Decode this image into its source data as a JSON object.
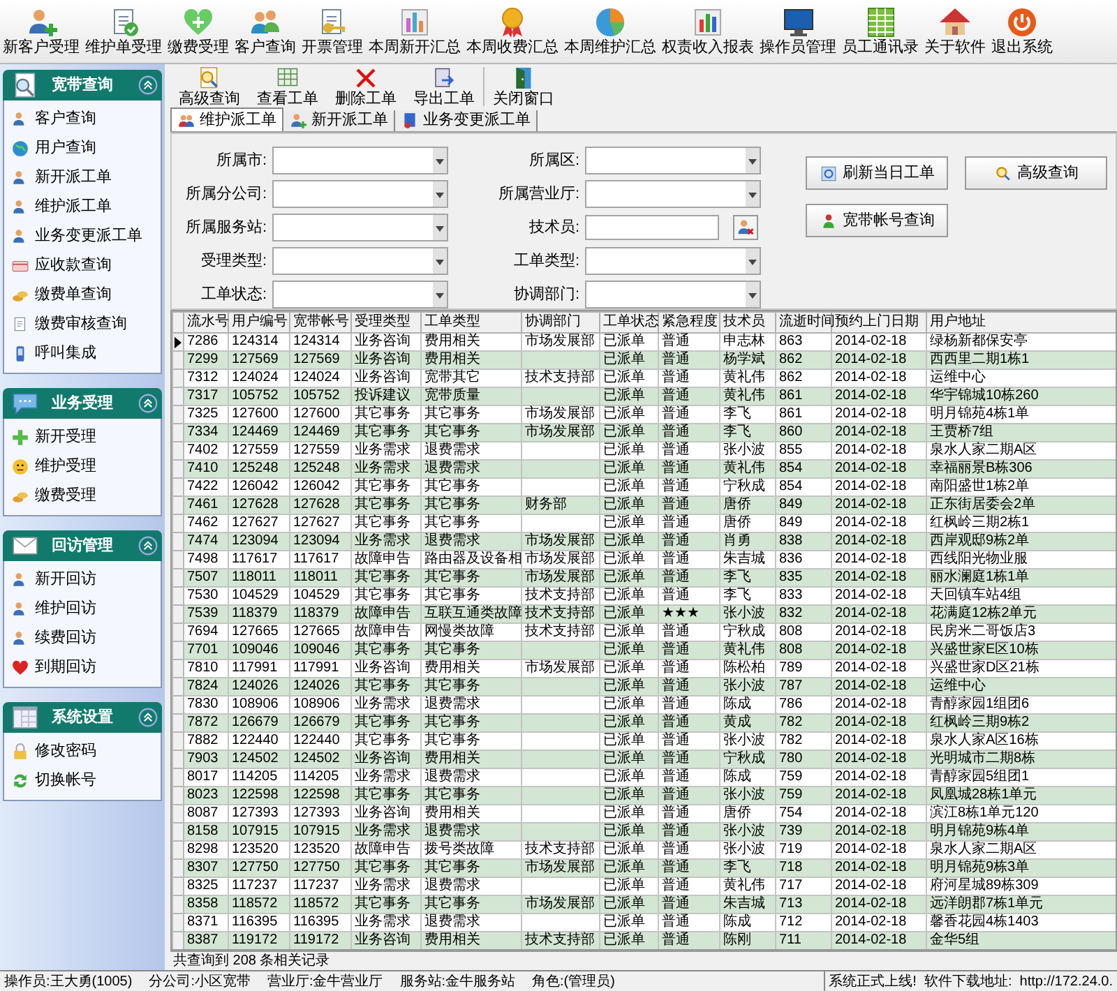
{
  "toolbar": [
    {
      "label": "新客户受理"
    },
    {
      "label": "维护单受理"
    },
    {
      "label": "缴费受理"
    },
    {
      "label": "客户查询"
    },
    {
      "label": "开票管理"
    },
    {
      "label": "本周新开汇总"
    },
    {
      "label": "本周收费汇总"
    },
    {
      "label": "本周维护汇总"
    },
    {
      "label": "权责收入报表"
    },
    {
      "label": "操作员管理"
    },
    {
      "label": "员工通讯录"
    },
    {
      "label": "关于软件"
    },
    {
      "label": "退出系统"
    }
  ],
  "sidebar": {
    "groups": [
      {
        "title": "宽带查询",
        "expanded": true,
        "items": [
          "客户查询",
          "用户查询",
          "新开派工单",
          "维护派工单",
          "业务变更派工单",
          "应收款查询",
          "缴费单查询",
          "缴费审核查询",
          "呼叫集成"
        ]
      },
      {
        "title": "业务受理",
        "expanded": true,
        "items": [
          "新开受理",
          "维护受理",
          "缴费受理"
        ]
      },
      {
        "title": "回访管理",
        "expanded": true,
        "items": [
          "新开回访",
          "维护回访",
          "续费回访",
          "到期回访"
        ]
      },
      {
        "title": "系统设置",
        "expanded": true,
        "items": [
          "修改密码",
          "切换帐号"
        ]
      }
    ]
  },
  "subtoolbar": [
    {
      "label": "高级查询"
    },
    {
      "label": "查看工单"
    },
    {
      "label": "删除工单"
    },
    {
      "label": "导出工单"
    },
    {
      "label": "关闭窗口"
    }
  ],
  "tabs": [
    {
      "label": "维护派工单",
      "selected": true
    },
    {
      "label": "新开派工单",
      "selected": false
    },
    {
      "label": "业务变更派工单",
      "selected": false
    }
  ],
  "filters": [
    {
      "label": "所属市:",
      "kind": "select"
    },
    {
      "label": "所属区:",
      "kind": "select"
    },
    {
      "label": "所属分公司:",
      "kind": "select"
    },
    {
      "label": "所属营业厅:",
      "kind": "select"
    },
    {
      "label": "所属服务站:",
      "kind": "select"
    },
    {
      "label": "技术员:",
      "kind": "text"
    },
    {
      "label": "受理类型:",
      "kind": "select"
    },
    {
      "label": "工单类型:",
      "kind": "select"
    },
    {
      "label": "工单状态:",
      "kind": "select"
    },
    {
      "label": "协调部门:",
      "kind": "select"
    }
  ],
  "buttons": [
    {
      "label": "刷新当日工单"
    },
    {
      "label": "高级查询"
    },
    {
      "label": "宽带帐号查询"
    }
  ],
  "table": {
    "columns": [
      "流水号",
      "用户编号",
      "宽带帐号",
      "受理类型",
      "工单类型",
      "协调部门",
      "工单状态",
      "紧急程度",
      "技术员",
      "流逝时间",
      "预约上门日期",
      "用户地址"
    ],
    "rows": [
      {
        "selected": true,
        "cells": [
          "7286",
          "124314",
          "124314",
          "业务咨询",
          "费用相关",
          "市场发展部",
          "已派单",
          "普通",
          "申志林",
          "863",
          "2014-02-18",
          "绿杨新都保安亭"
        ]
      },
      {
        "selected": false,
        "cells": [
          "7299",
          "127569",
          "127569",
          "业务咨询",
          "费用相关",
          null,
          "已派单",
          "普通",
          "杨学斌",
          "862",
          "2014-02-18",
          "西西里二期1栋1"
        ]
      },
      {
        "selected": false,
        "cells": [
          "7312",
          "124024",
          "124024",
          "业务咨询",
          "宽带其它",
          "技术支持部",
          "已派单",
          "普通",
          "黄礼伟",
          "862",
          "2014-02-18",
          "运维中心"
        ]
      },
      {
        "selected": false,
        "cells": [
          "7317",
          "105752",
          "105752",
          "投诉建议",
          "宽带质量",
          null,
          "已派单",
          "普通",
          "黄礼伟",
          "861",
          "2014-02-18",
          "华宇锦城10栋260"
        ]
      },
      {
        "selected": false,
        "cells": [
          "7325",
          "127600",
          "127600",
          "其它事务",
          "其它事务",
          "市场发展部",
          "已派单",
          "普通",
          "李飞",
          "861",
          "2014-02-18",
          "明月锦苑4栋1单"
        ]
      },
      {
        "selected": false,
        "cells": [
          "7334",
          "124469",
          "124469",
          "其它事务",
          "其它事务",
          "市场发展部",
          "已派单",
          "普通",
          "李飞",
          "860",
          "2014-02-18",
          "王贾桥7组"
        ]
      },
      {
        "selected": false,
        "cells": [
          "7402",
          "127559",
          "127559",
          "业务需求",
          "退费需求",
          null,
          "已派单",
          "普通",
          "张小波",
          "855",
          "2014-02-18",
          "泉水人家二期A区"
        ]
      },
      {
        "selected": false,
        "cells": [
          "7410",
          "125248",
          "125248",
          "业务需求",
          "退费需求",
          null,
          "已派单",
          "普通",
          "黄礼伟",
          "854",
          "2014-02-18",
          "幸福丽景B栋306"
        ]
      },
      {
        "selected": false,
        "cells": [
          "7422",
          "126042",
          "126042",
          "其它事务",
          "其它事务",
          null,
          "已派单",
          "普通",
          "宁秋成",
          "854",
          "2014-02-18",
          "南阳盛世1栋2单"
        ]
      },
      {
        "selected": false,
        "cells": [
          "7461",
          "127628",
          "127628",
          "其它事务",
          "其它事务",
          "财务部",
          "已派单",
          "普通",
          "唐侨",
          "849",
          "2014-02-18",
          "正东街居委会2单"
        ]
      },
      {
        "selected": false,
        "cells": [
          "7462",
          "127627",
          "127627",
          "其它事务",
          "其它事务",
          null,
          "已派单",
          "普通",
          "唐侨",
          "849",
          "2014-02-18",
          "红枫岭三期2栋1"
        ]
      },
      {
        "selected": false,
        "cells": [
          "7474",
          "123094",
          "123094",
          "业务需求",
          "退费需求",
          "市场发展部",
          "已派单",
          "普通",
          "肖勇",
          "838",
          "2014-02-18",
          "西岸观邸9栋2单"
        ]
      },
      {
        "selected": false,
        "cells": [
          "7498",
          "117617",
          "117617",
          "故障申告",
          "路由器及设备相",
          "市场发展部",
          "已派单",
          "普通",
          "朱吉城",
          "836",
          "2014-02-18",
          "西线阳光物业服"
        ]
      },
      {
        "selected": false,
        "cells": [
          "7507",
          "118011",
          "118011",
          "其它事务",
          "其它事务",
          "市场发展部",
          "已派单",
          "普通",
          "李飞",
          "835",
          "2014-02-18",
          "丽水澜庭1栋1单"
        ]
      },
      {
        "selected": false,
        "cells": [
          "7530",
          "104529",
          "104529",
          "其它事务",
          "其它事务",
          "技术支持部",
          "已派单",
          "普通",
          "李飞",
          "833",
          "2014-02-18",
          "天回镇车站4组"
        ]
      },
      {
        "selected": false,
        "cells": [
          "7539",
          "118379",
          "118379",
          "故障申告",
          "互联互通类故障",
          "技术支持部",
          "已派单",
          "★★★",
          "张小波",
          "832",
          "2014-02-18",
          "花满庭12栋2单元"
        ]
      },
      {
        "selected": false,
        "cells": [
          "7694",
          "127665",
          "127665",
          "故障申告",
          "网慢类故障",
          "技术支持部",
          "已派单",
          "普通",
          "宁秋成",
          "808",
          "2014-02-18",
          "民房米二哥饭店3"
        ]
      },
      {
        "selected": false,
        "cells": [
          "7701",
          "109046",
          "109046",
          "其它事务",
          "其它事务",
          null,
          "已派单",
          "普通",
          "黄礼伟",
          "808",
          "2014-02-18",
          "兴盛世家E区10栋"
        ]
      },
      {
        "selected": false,
        "cells": [
          "7810",
          "117991",
          "117991",
          "业务咨询",
          "费用相关",
          "市场发展部",
          "已派单",
          "普通",
          "陈松柏",
          "789",
          "2014-02-18",
          "兴盛世家D区21栋"
        ]
      },
      {
        "selected": false,
        "cells": [
          "7824",
          "124026",
          "124026",
          "其它事务",
          "其它事务",
          null,
          "已派单",
          "普通",
          "张小波",
          "787",
          "2014-02-18",
          "运维中心"
        ]
      },
      {
        "selected": false,
        "cells": [
          "7830",
          "108906",
          "108906",
          "业务需求",
          "退费需求",
          null,
          "已派单",
          "普通",
          "陈成",
          "786",
          "2014-02-18",
          "青醇家园1组团6"
        ]
      },
      {
        "selected": false,
        "cells": [
          "7872",
          "126679",
          "126679",
          "其它事务",
          "其它事务",
          null,
          "已派单",
          "普通",
          "黄成",
          "782",
          "2014-02-18",
          "红枫岭三期9栋2"
        ]
      },
      {
        "selected": false,
        "cells": [
          "7882",
          "122440",
          "122440",
          "其它事务",
          "其它事务",
          null,
          "已派单",
          "普通",
          "张小波",
          "782",
          "2014-02-18",
          "泉水人家A区16栋"
        ]
      },
      {
        "selected": false,
        "cells": [
          "7903",
          "124502",
          "124502",
          "业务咨询",
          "费用相关",
          null,
          "已派单",
          "普通",
          "宁秋成",
          "780",
          "2014-02-18",
          "光明城市二期8栋"
        ]
      },
      {
        "selected": false,
        "cells": [
          "8017",
          "114205",
          "114205",
          "业务需求",
          "退费需求",
          null,
          "已派单",
          "普通",
          "陈成",
          "759",
          "2014-02-18",
          "青醇家园5组团1"
        ]
      },
      {
        "selected": false,
        "cells": [
          "8023",
          "122598",
          "122598",
          "其它事务",
          "其它事务",
          null,
          "已派单",
          "普通",
          "张小波",
          "759",
          "2014-02-18",
          "凤凰城28栋1单元"
        ]
      },
      {
        "selected": false,
        "cells": [
          "8087",
          "127393",
          "127393",
          "业务咨询",
          "费用相关",
          null,
          "已派单",
          "普通",
          "唐侨",
          "754",
          "2014-02-18",
          "滨江8栋1单元120"
        ]
      },
      {
        "selected": false,
        "cells": [
          "8158",
          "107915",
          "107915",
          "业务需求",
          "退费需求",
          null,
          "已派单",
          "普通",
          "张小波",
          "739",
          "2014-02-18",
          "明月锦苑9栋4单"
        ]
      },
      {
        "selected": false,
        "cells": [
          "8298",
          "123520",
          "123520",
          "故障申告",
          "拨号类故障",
          "技术支持部",
          "已派单",
          "普通",
          "张小波",
          "719",
          "2014-02-18",
          "泉水人家二期A区"
        ]
      },
      {
        "selected": false,
        "cells": [
          "8307",
          "127750",
          "127750",
          "其它事务",
          "其它事务",
          "市场发展部",
          "已派单",
          "普通",
          "李飞",
          "718",
          "2014-02-18",
          "明月锦苑9栋3单"
        ]
      },
      {
        "selected": false,
        "cells": [
          "8325",
          "117237",
          "117237",
          "业务需求",
          "退费需求",
          null,
          "已派单",
          "普通",
          "黄礼伟",
          "717",
          "2014-02-18",
          "府河星城89栋309"
        ]
      },
      {
        "selected": false,
        "cells": [
          "8358",
          "118572",
          "118572",
          "其它事务",
          "其它事务",
          "市场发展部",
          "已派单",
          "普通",
          "朱吉城",
          "713",
          "2014-02-18",
          "远洋朗郡7栋1单元"
        ]
      },
      {
        "selected": false,
        "cells": [
          "8371",
          "116395",
          "116395",
          "业务需求",
          "退费需求",
          null,
          "已派单",
          "普通",
          "陈成",
          "712",
          "2014-02-18",
          "馨香花园4栋1403"
        ]
      },
      {
        "selected": false,
        "cells": [
          "8387",
          "119172",
          "119172",
          "业务咨询",
          "费用相关",
          "技术支持部",
          "已派单",
          "普通",
          "陈刚",
          "711",
          "2014-02-18",
          "金华5组"
        ]
      }
    ]
  },
  "record_count": "共查询到 208 条相关记录",
  "status_bar": [
    "操作员:王大勇(1005)",
    "分公司:小区宽带",
    "营业厅:金牛营业厅",
    "服务站:金牛服务站",
    "角色:(管理员)",
    "系统正式上线!  软件下载地址:  http://172.24.0."
  ]
}
